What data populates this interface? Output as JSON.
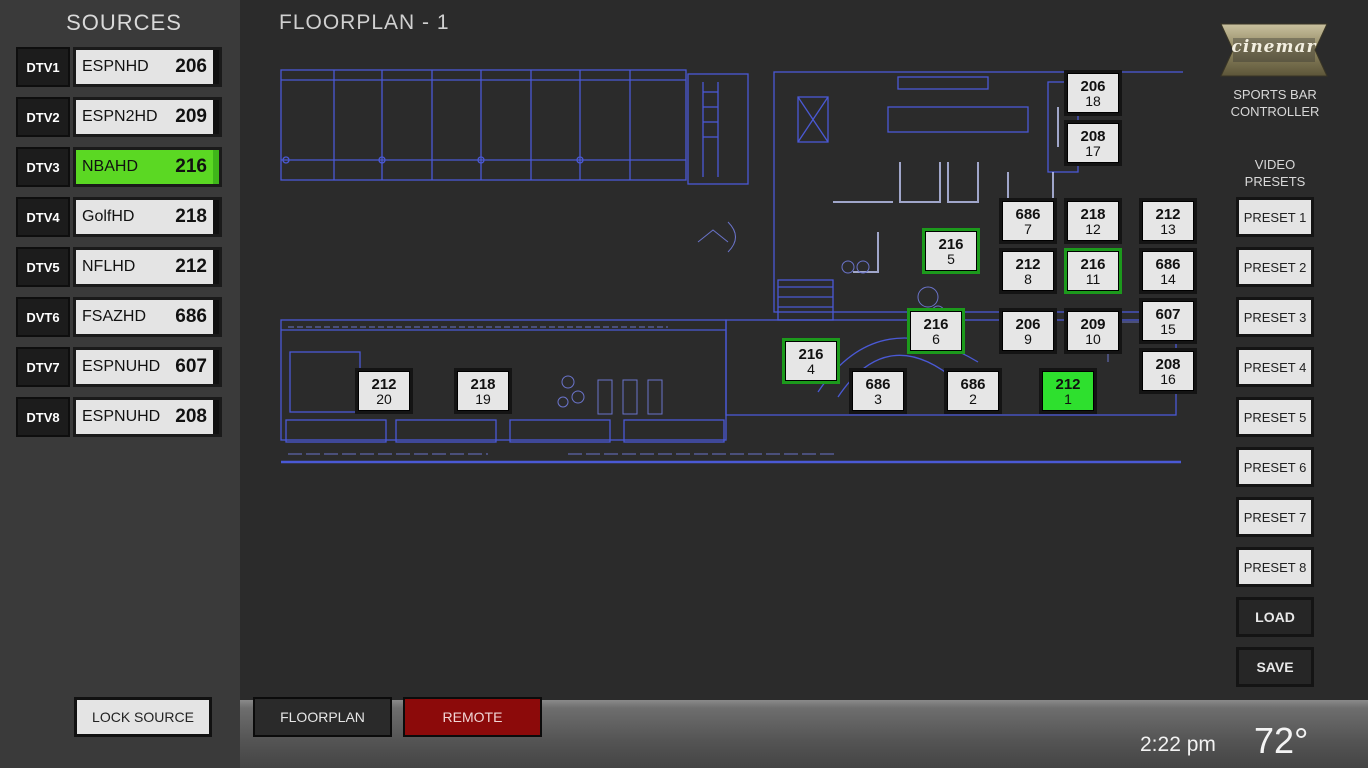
{
  "sidebar": {
    "title": "SOURCES",
    "sources": [
      {
        "tag": "DTV1",
        "name": "ESPNHD",
        "channel": "206"
      },
      {
        "tag": "DTV2",
        "name": "ESPN2HD",
        "channel": "209"
      },
      {
        "tag": "DTV3",
        "name": "NBAHD",
        "channel": "216"
      },
      {
        "tag": "DTV4",
        "name": "GolfHD",
        "channel": "218"
      },
      {
        "tag": "DTV5",
        "name": "NFLHD",
        "channel": "212"
      },
      {
        "tag": "DVT6",
        "name": "FSAZHD",
        "channel": "686"
      },
      {
        "tag": "DTV7",
        "name": "ESPNUHD",
        "channel": "607"
      },
      {
        "tag": "DTV8",
        "name": "ESPNUHD",
        "channel": "208"
      }
    ],
    "selected_index": 2,
    "lock_label": "LOCK SOURCE"
  },
  "main": {
    "title": "FLOORPLAN  -  1",
    "tvs": [
      {
        "channel": "206",
        "number": "18"
      },
      {
        "channel": "208",
        "number": "17"
      },
      {
        "channel": "686",
        "number": "7"
      },
      {
        "channel": "218",
        "number": "12"
      },
      {
        "channel": "212",
        "number": "13"
      },
      {
        "channel": "216",
        "number": "5"
      },
      {
        "channel": "212",
        "number": "8"
      },
      {
        "channel": "216",
        "number": "11"
      },
      {
        "channel": "686",
        "number": "14"
      },
      {
        "channel": "216",
        "number": "6"
      },
      {
        "channel": "206",
        "number": "9"
      },
      {
        "channel": "209",
        "number": "10"
      },
      {
        "channel": "607",
        "number": "15"
      },
      {
        "channel": "216",
        "number": "4"
      },
      {
        "channel": "208",
        "number": "16"
      },
      {
        "channel": "212",
        "number": "20"
      },
      {
        "channel": "218",
        "number": "19"
      },
      {
        "channel": "686",
        "number": "3"
      },
      {
        "channel": "686",
        "number": "2"
      },
      {
        "channel": "212",
        "number": "1"
      }
    ]
  },
  "right": {
    "logo": "cinemar",
    "app_label_line1": "SPORTS BAR",
    "app_label_line2": "CONTROLLER",
    "presets_label_line1": "VIDEO",
    "presets_label_line2": "PRESETS",
    "presets": [
      "PRESET 1",
      "PRESET 2",
      "PRESET 3",
      "PRESET 4",
      "PRESET 5",
      "PRESET 6",
      "PRESET 7",
      "PRESET 8"
    ],
    "load_label": "LOAD",
    "save_label": "SAVE"
  },
  "bottom": {
    "floorplan_tab": "FLOORPLAN",
    "remote_tab": "REMOTE",
    "time": "2:22 pm",
    "temperature": "72°"
  },
  "colors": {
    "selected_green": "#5bd823",
    "outline_green": "#1c9a1c",
    "remote_red": "#8c0a0a",
    "blueprint": "#5a6cff"
  },
  "icons": {
    "logo": "cinemar-logo-icon"
  }
}
